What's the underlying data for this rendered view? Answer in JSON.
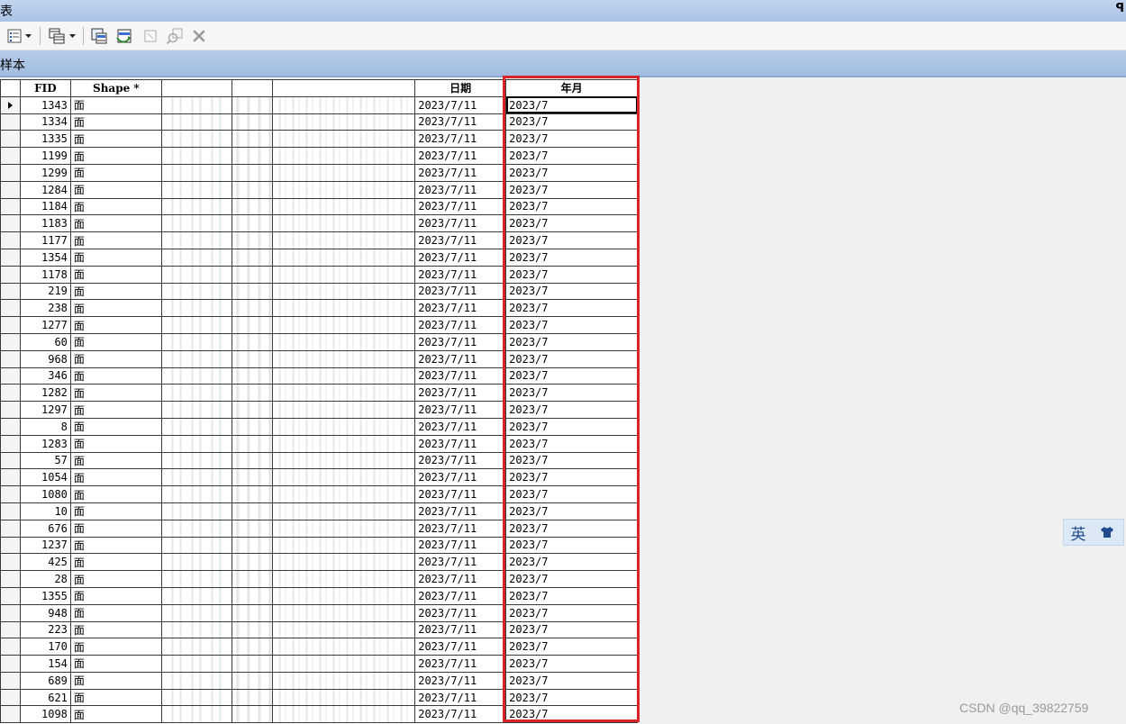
{
  "window": {
    "title": "表",
    "pin_glyph": "ꟼ"
  },
  "toolbar": {
    "buttons": [
      {
        "name": "table-options-icon"
      },
      {
        "name": "related-tables-icon"
      },
      {
        "name": "select-by-attributes-icon"
      },
      {
        "name": "switch-selection-icon"
      },
      {
        "name": "clear-selection-icon"
      },
      {
        "name": "zoom-to-selected-icon"
      },
      {
        "name": "delete-selected-icon"
      }
    ]
  },
  "tab": {
    "label": "样本"
  },
  "table": {
    "headers": {
      "fid": "FID",
      "shape": "Shape *",
      "date": "日期",
      "year_month": "年月"
    },
    "rows": [
      {
        "fid": "1343",
        "shape": "面",
        "date": "2023/7/11",
        "ym": "2023/7"
      },
      {
        "fid": "1334",
        "shape": "面",
        "date": "2023/7/11",
        "ym": "2023/7"
      },
      {
        "fid": "1335",
        "shape": "面",
        "date": "2023/7/11",
        "ym": "2023/7"
      },
      {
        "fid": "1199",
        "shape": "面",
        "date": "2023/7/11",
        "ym": "2023/7"
      },
      {
        "fid": "1299",
        "shape": "面",
        "date": "2023/7/11",
        "ym": "2023/7"
      },
      {
        "fid": "1284",
        "shape": "面",
        "date": "2023/7/11",
        "ym": "2023/7"
      },
      {
        "fid": "1184",
        "shape": "面",
        "date": "2023/7/11",
        "ym": "2023/7"
      },
      {
        "fid": "1183",
        "shape": "面",
        "date": "2023/7/11",
        "ym": "2023/7"
      },
      {
        "fid": "1177",
        "shape": "面",
        "date": "2023/7/11",
        "ym": "2023/7"
      },
      {
        "fid": "1354",
        "shape": "面",
        "date": "2023/7/11",
        "ym": "2023/7"
      },
      {
        "fid": "1178",
        "shape": "面",
        "date": "2023/7/11",
        "ym": "2023/7"
      },
      {
        "fid": "219",
        "shape": "面",
        "date": "2023/7/11",
        "ym": "2023/7"
      },
      {
        "fid": "238",
        "shape": "面",
        "date": "2023/7/11",
        "ym": "2023/7"
      },
      {
        "fid": "1277",
        "shape": "面",
        "date": "2023/7/11",
        "ym": "2023/7"
      },
      {
        "fid": "60",
        "shape": "面",
        "date": "2023/7/11",
        "ym": "2023/7"
      },
      {
        "fid": "968",
        "shape": "面",
        "date": "2023/7/11",
        "ym": "2023/7"
      },
      {
        "fid": "346",
        "shape": "面",
        "date": "2023/7/11",
        "ym": "2023/7"
      },
      {
        "fid": "1282",
        "shape": "面",
        "date": "2023/7/11",
        "ym": "2023/7"
      },
      {
        "fid": "1297",
        "shape": "面",
        "date": "2023/7/11",
        "ym": "2023/7"
      },
      {
        "fid": "8",
        "shape": "面",
        "date": "2023/7/11",
        "ym": "2023/7"
      },
      {
        "fid": "1283",
        "shape": "面",
        "date": "2023/7/11",
        "ym": "2023/7"
      },
      {
        "fid": "57",
        "shape": "面",
        "date": "2023/7/11",
        "ym": "2023/7"
      },
      {
        "fid": "1054",
        "shape": "面",
        "date": "2023/7/11",
        "ym": "2023/7"
      },
      {
        "fid": "1080",
        "shape": "面",
        "date": "2023/7/11",
        "ym": "2023/7"
      },
      {
        "fid": "10",
        "shape": "面",
        "date": "2023/7/11",
        "ym": "2023/7"
      },
      {
        "fid": "676",
        "shape": "面",
        "date": "2023/7/11",
        "ym": "2023/7"
      },
      {
        "fid": "1237",
        "shape": "面",
        "date": "2023/7/11",
        "ym": "2023/7"
      },
      {
        "fid": "425",
        "shape": "面",
        "date": "2023/7/11",
        "ym": "2023/7"
      },
      {
        "fid": "28",
        "shape": "面",
        "date": "2023/7/11",
        "ym": "2023/7"
      },
      {
        "fid": "1355",
        "shape": "面",
        "date": "2023/7/11",
        "ym": "2023/7"
      },
      {
        "fid": "948",
        "shape": "面",
        "date": "2023/7/11",
        "ym": "2023/7"
      },
      {
        "fid": "223",
        "shape": "面",
        "date": "2023/7/11",
        "ym": "2023/7"
      },
      {
        "fid": "170",
        "shape": "面",
        "date": "2023/7/11",
        "ym": "2023/7"
      },
      {
        "fid": "154",
        "shape": "面",
        "date": "2023/7/11",
        "ym": "2023/7"
      },
      {
        "fid": "689",
        "shape": "面",
        "date": "2023/7/11",
        "ym": "2023/7"
      },
      {
        "fid": "621",
        "shape": "面",
        "date": "2023/7/11",
        "ym": "2023/7"
      },
      {
        "fid": "1098",
        "shape": "面",
        "date": "2023/7/11",
        "ym": "2023/7"
      }
    ]
  },
  "ime": {
    "language": "英",
    "skin_icon": "shirt-icon"
  },
  "watermark": "CSDN @qq_39822759",
  "colors": {
    "highlight": "#d9232b",
    "title_bar": "#aac3e6",
    "tab_bar": "#a2bde2"
  }
}
